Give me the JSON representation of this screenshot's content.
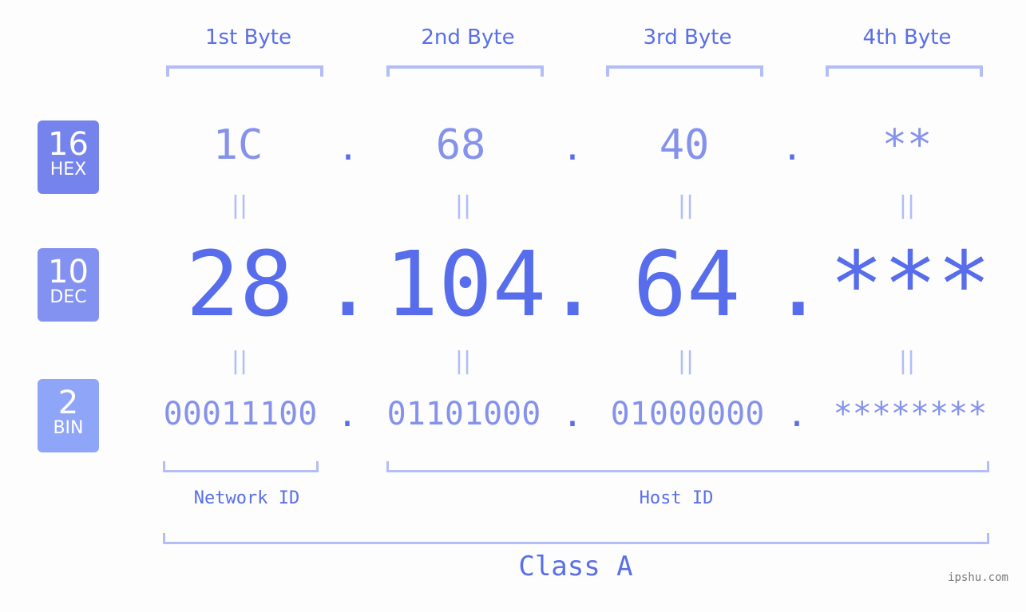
{
  "bytes": [
    {
      "header": "1st Byte",
      "hex": "1C",
      "dec": "28",
      "bin": "00011100"
    },
    {
      "header": "2nd Byte",
      "hex": "68",
      "dec": "104",
      "bin": "01101000"
    },
    {
      "header": "3rd Byte",
      "hex": "40",
      "dec": "64",
      "bin": "01000000"
    },
    {
      "header": "4th Byte",
      "hex": "**",
      "dec": "***",
      "bin": "********"
    }
  ],
  "badges": {
    "hex": {
      "base": "16",
      "label": "HEX",
      "color": "#7583ec"
    },
    "dec": {
      "base": "10",
      "label": "DEC",
      "color": "#8392f1"
    },
    "bin": {
      "base": "2",
      "label": "BIN",
      "color": "#8fa5f8"
    }
  },
  "separator": ".",
  "equals": "=",
  "segments": {
    "network": "Network ID",
    "host": "Host ID"
  },
  "class_label": "Class A",
  "watermark": "ipshu.com",
  "colors": {
    "primary": "#576deb",
    "secondary": "#8592ec",
    "bracket": "#b3bdf7",
    "background": "#fcfdfc"
  }
}
